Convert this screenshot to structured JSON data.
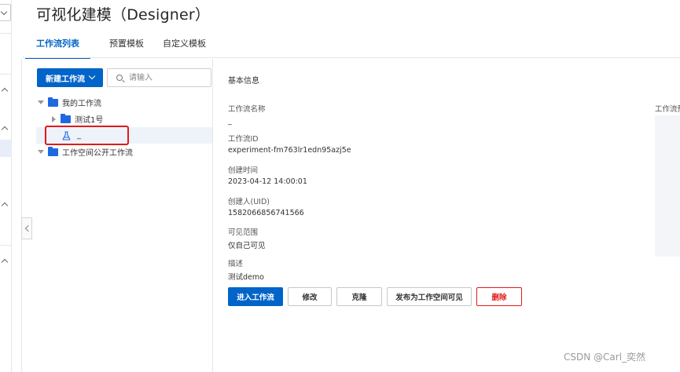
{
  "page": {
    "title": "可视化建模（Designer）"
  },
  "tabs": [
    {
      "label": "工作流列表",
      "active": true
    },
    {
      "label": "预置模板",
      "active": false
    },
    {
      "label": "自定义模板",
      "active": false
    }
  ],
  "toolbar": {
    "new_workflow_label": "新建工作流",
    "search_placeholder": "请输入"
  },
  "tree": {
    "my_workflows": "我的工作流",
    "test_folder": "测试1号",
    "selected_experiment": "_",
    "workspace_public": "工作空间公开工作流"
  },
  "details": {
    "section_title": "基本信息",
    "name_label": "工作流名称",
    "name_value": "_",
    "id_label": "工作流ID",
    "id_value": "experiment-fm763lr1edn95azj5e",
    "created_label": "创建时间",
    "created_value": "2023-04-12 14:00:01",
    "creator_label": "创建人(UID)",
    "creator_value": "1582066856741566",
    "visibility_label": "可见范围",
    "visibility_value": "仅自己可见",
    "desc_label": "描述",
    "desc_value": "测试demo"
  },
  "actions": {
    "enter": "进入工作流",
    "edit": "修改",
    "clone": "克隆",
    "publish": "发布为工作空间可见",
    "delete": "删除"
  },
  "right_panel": {
    "label": "工作流预"
  },
  "watermark": "CSDN @Carl_奕然",
  "colors": {
    "primary": "#0064c8",
    "danger": "#e11a1a",
    "folder": "#1d6ae0"
  }
}
